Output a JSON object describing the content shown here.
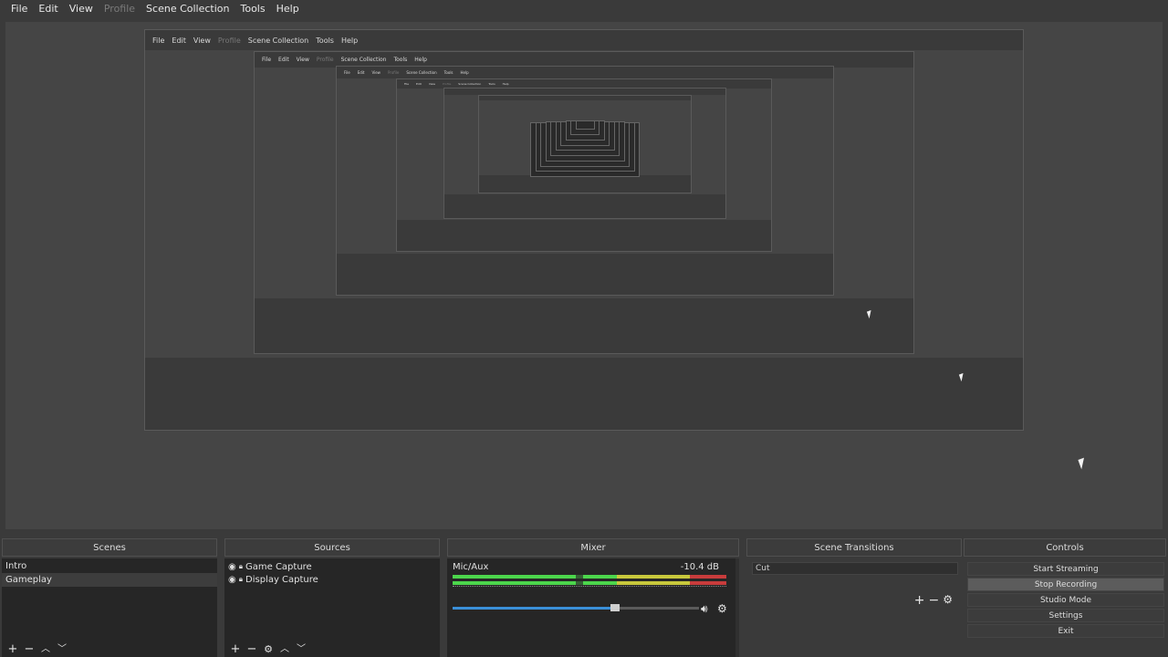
{
  "menu": {
    "items": [
      {
        "label": "File",
        "disabled": false
      },
      {
        "label": "Edit",
        "disabled": false
      },
      {
        "label": "View",
        "disabled": false
      },
      {
        "label": "Profile",
        "disabled": true
      },
      {
        "label": "Scene Collection",
        "disabled": false
      },
      {
        "label": "Tools",
        "disabled": false
      },
      {
        "label": "Help",
        "disabled": false
      }
    ]
  },
  "docks": {
    "scenes": {
      "title": "Scenes",
      "items": [
        "Intro",
        "Gameplay"
      ],
      "selected": 1
    },
    "sources": {
      "title": "Sources",
      "items": [
        "Game Capture",
        "Display Capture"
      ]
    },
    "mixer": {
      "title": "Mixer",
      "channel": "Mic/Aux",
      "db": "-10.4 dB",
      "volume_fraction": 0.66
    },
    "transitions": {
      "title": "Scene Transitions",
      "selected": "Cut"
    },
    "controls": {
      "title": "Controls",
      "buttons": [
        "Start Streaming",
        "Stop Recording",
        "Studio Mode",
        "Settings",
        "Exit"
      ],
      "active_index": 1
    }
  },
  "icons": {
    "add": "plus-icon",
    "remove": "minus-icon",
    "up": "chevron-up-icon",
    "down": "chevron-down-icon",
    "settings": "gear-icon",
    "eye": "eye-icon",
    "lock": "lock-icon",
    "speaker": "speaker-icon"
  },
  "colors": {
    "meter_green": "#4cd64c",
    "meter_yellow": "#c8c83c",
    "meter_red": "#c83c3c",
    "volume_blue": "#3a8fd8"
  }
}
